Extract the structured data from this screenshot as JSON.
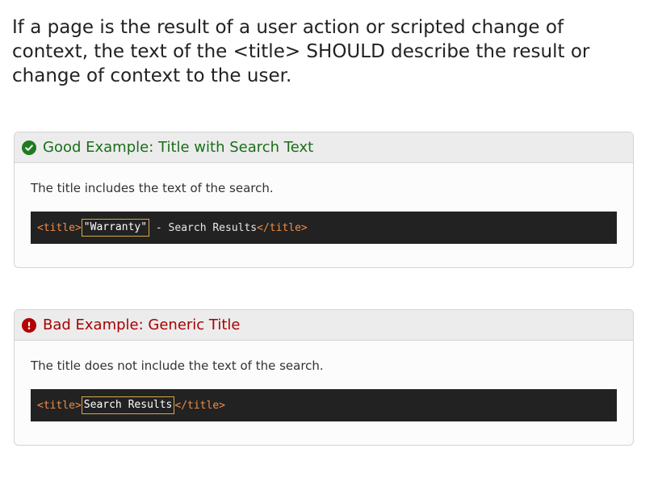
{
  "intro": "If a page is the result of a user action or scripted change of context, the text of the <title> SHOULD describe the result or change of context to the user.",
  "good_example": {
    "heading": "Good Example: Title with Search Text",
    "icon": "check-circle-icon",
    "description": "The title includes the text of the search.",
    "code": {
      "open_tag": "<title>",
      "highlight": "\"Warranty\"",
      "rest": " - Search Results",
      "close_tag": "</title>"
    }
  },
  "bad_example": {
    "heading": "Bad Example: Generic Title",
    "icon": "exclamation-circle-icon",
    "description": "The title does not include the text of the search.",
    "code": {
      "open_tag": "<title>",
      "highlight": "Search Results",
      "close_tag": "</title>"
    }
  },
  "colors": {
    "good": "#1a6e1a",
    "bad": "#a80000",
    "code_bg": "#222222",
    "tag": "#f08d49"
  }
}
